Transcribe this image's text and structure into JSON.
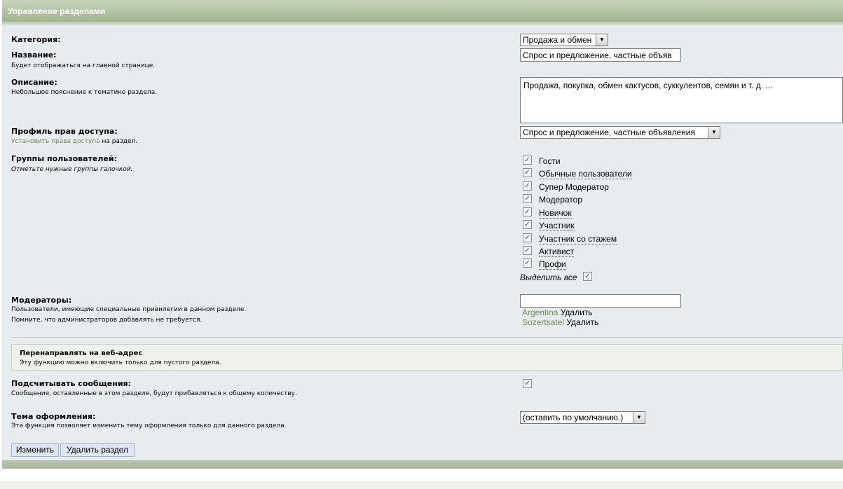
{
  "header": {
    "title": "Управление разделами"
  },
  "category": {
    "label": "Категория:",
    "value": "Продажа и обмен"
  },
  "name": {
    "label": "Название:",
    "hint": "Будет отображаться на главной странице.",
    "value": "Спрос и предложение, частные объяв"
  },
  "description": {
    "label": "Описание:",
    "hint": "Небольшое пояснение к тематике раздела.",
    "value": "Продажа, покупка, обмен кактусов, суккулентов, семян и т. д. ..."
  },
  "access": {
    "label": "Профиль прав доступа:",
    "hint_link": "Установить права доступа",
    "hint_rest": " на раздел.",
    "value": "Спрос и предложение, частные объявления"
  },
  "groups": {
    "label": "Группы пользователей:",
    "hint": "Отметьте нужные группы галочкой.",
    "items": [
      {
        "label": "Гости",
        "checked": true
      },
      {
        "label": "Обычные пользователи",
        "checked": true
      },
      {
        "label": "Супер Модератор",
        "checked": true
      },
      {
        "label": "Модератор",
        "checked": true
      },
      {
        "label": "Новичок",
        "checked": true
      },
      {
        "label": "Участник",
        "checked": true
      },
      {
        "label": "Участник со стажем",
        "checked": true
      },
      {
        "label": "Активист",
        "checked": true
      },
      {
        "label": "Профи",
        "checked": true
      }
    ],
    "select_all": "Выделить все"
  },
  "moderators": {
    "label": "Модераторы:",
    "hint1": "Пользователи, имеющие специальные привилегии в данном разделе.",
    "hint2": "Помните, что администраторов добавлять не требуется.",
    "input_value": "",
    "list": [
      {
        "name": "Argentina",
        "action": "Удалить"
      },
      {
        "name": "Sozertsatel",
        "action": "Удалить"
      }
    ]
  },
  "redirect": {
    "title": "Перенаправлять на веб-адрес",
    "subtitle": "Эту функцию можно включить только для пустого раздела."
  },
  "count_posts": {
    "label": "Подсчитывать сообщения:",
    "hint": "Сообщения, оставленные в этом разделе, будут прибавляться к общему количеству.",
    "checked": true
  },
  "theme": {
    "label": "Тема оформления:",
    "hint": "Эта функция позволяет изменить тему оформления только для данного раздела.",
    "value": "(оставить по умолчанию.)"
  },
  "buttons": {
    "save": "Изменить",
    "delete": "Удалить раздел"
  },
  "colors": {
    "header": "#9fb58f",
    "panel": "#e9ecef",
    "link": "#6b8a55",
    "button": "#dde6f1"
  }
}
